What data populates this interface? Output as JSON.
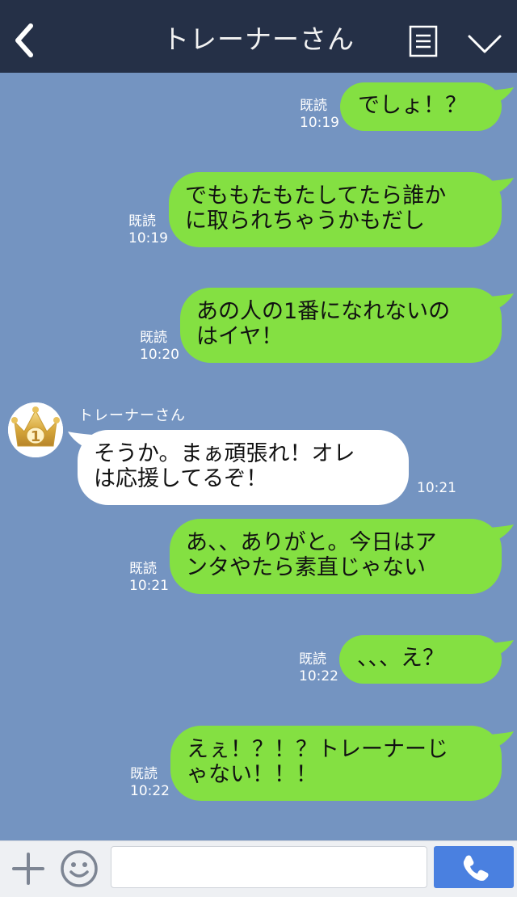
{
  "header": {
    "title": "トレーナーさん",
    "back_icon": "chevron-left-icon",
    "menu_icon": "menu-list-icon",
    "collapse_icon": "chevron-down-icon"
  },
  "messages": [
    {
      "direction": "outgoing",
      "text": "でしょ！？",
      "read": "既読",
      "time": "10:19"
    },
    {
      "direction": "outgoing",
      "text": "でももたもたしてたら誰か\nに取られちゃうかもだし",
      "read": "既読",
      "time": "10:19"
    },
    {
      "direction": "outgoing",
      "text": "あの人の1番になれないの\nはイヤ！",
      "read": "既読",
      "time": "10:20"
    },
    {
      "direction": "incoming",
      "sender": "トレーナーさん",
      "text": "そうか。まぁ頑張れ！オレ\nは応援してるぞ！",
      "time": "10:21",
      "avatar_icon": "gold-crown-rank-1-icon",
      "avatar_number": "1"
    },
    {
      "direction": "outgoing",
      "text": "あ、、ありがと。今日はア\nンタやたら素直じゃない",
      "read": "既読",
      "time": "10:21"
    },
    {
      "direction": "outgoing",
      "text": "、、、え？",
      "read": "既読",
      "time": "10:22"
    },
    {
      "direction": "outgoing",
      "text": "えぇ！？！？トレーナーじ\nゃない！！！",
      "read": "既読",
      "time": "10:22"
    }
  ],
  "footer": {
    "plus_icon": "plus-icon",
    "emoji_icon": "smiley-icon",
    "input_value": "",
    "call_icon": "phone-icon"
  },
  "colors": {
    "header_bg": "#253047",
    "chat_bg": "#7494c1",
    "outgoing_bubble": "#84e042",
    "incoming_bubble": "#ffffff",
    "call_button": "#4a80e0"
  }
}
